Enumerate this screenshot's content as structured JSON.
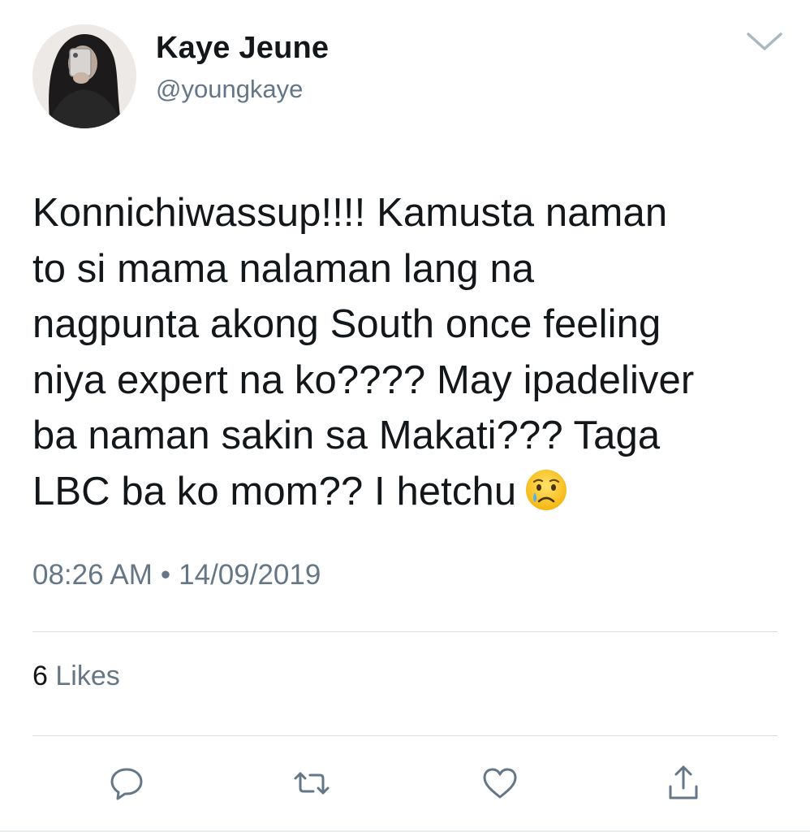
{
  "author": {
    "display_name": "Kaye Jeune",
    "handle": "@youngkaye",
    "avatar_icon": "profile-photo"
  },
  "tweet": {
    "lines": [
      "Konnichiwassup!!!! Kamusta naman",
      "to si mama nalaman lang na",
      "nagpunta akong South once feeling",
      "niya expert na ko???? May ipadeliver",
      "ba naman sakin sa Makati??? Taga",
      "LBC ba ko mom?? I hetchu"
    ],
    "emoji": "crying-face-emoji",
    "time": "08:26 AM",
    "separator": "•",
    "date": "14/09/2019"
  },
  "stats": {
    "likes_count": "6",
    "likes_label": "Likes"
  },
  "actions": [
    {
      "name": "reply",
      "icon": "reply-icon"
    },
    {
      "name": "retweet",
      "icon": "retweet-icon"
    },
    {
      "name": "like",
      "icon": "heart-icon"
    },
    {
      "name": "share",
      "icon": "share-icon"
    }
  ],
  "colors": {
    "text_primary": "#14171a",
    "text_secondary": "#657786",
    "divider": "#d8dde1",
    "icon": "#657786"
  }
}
